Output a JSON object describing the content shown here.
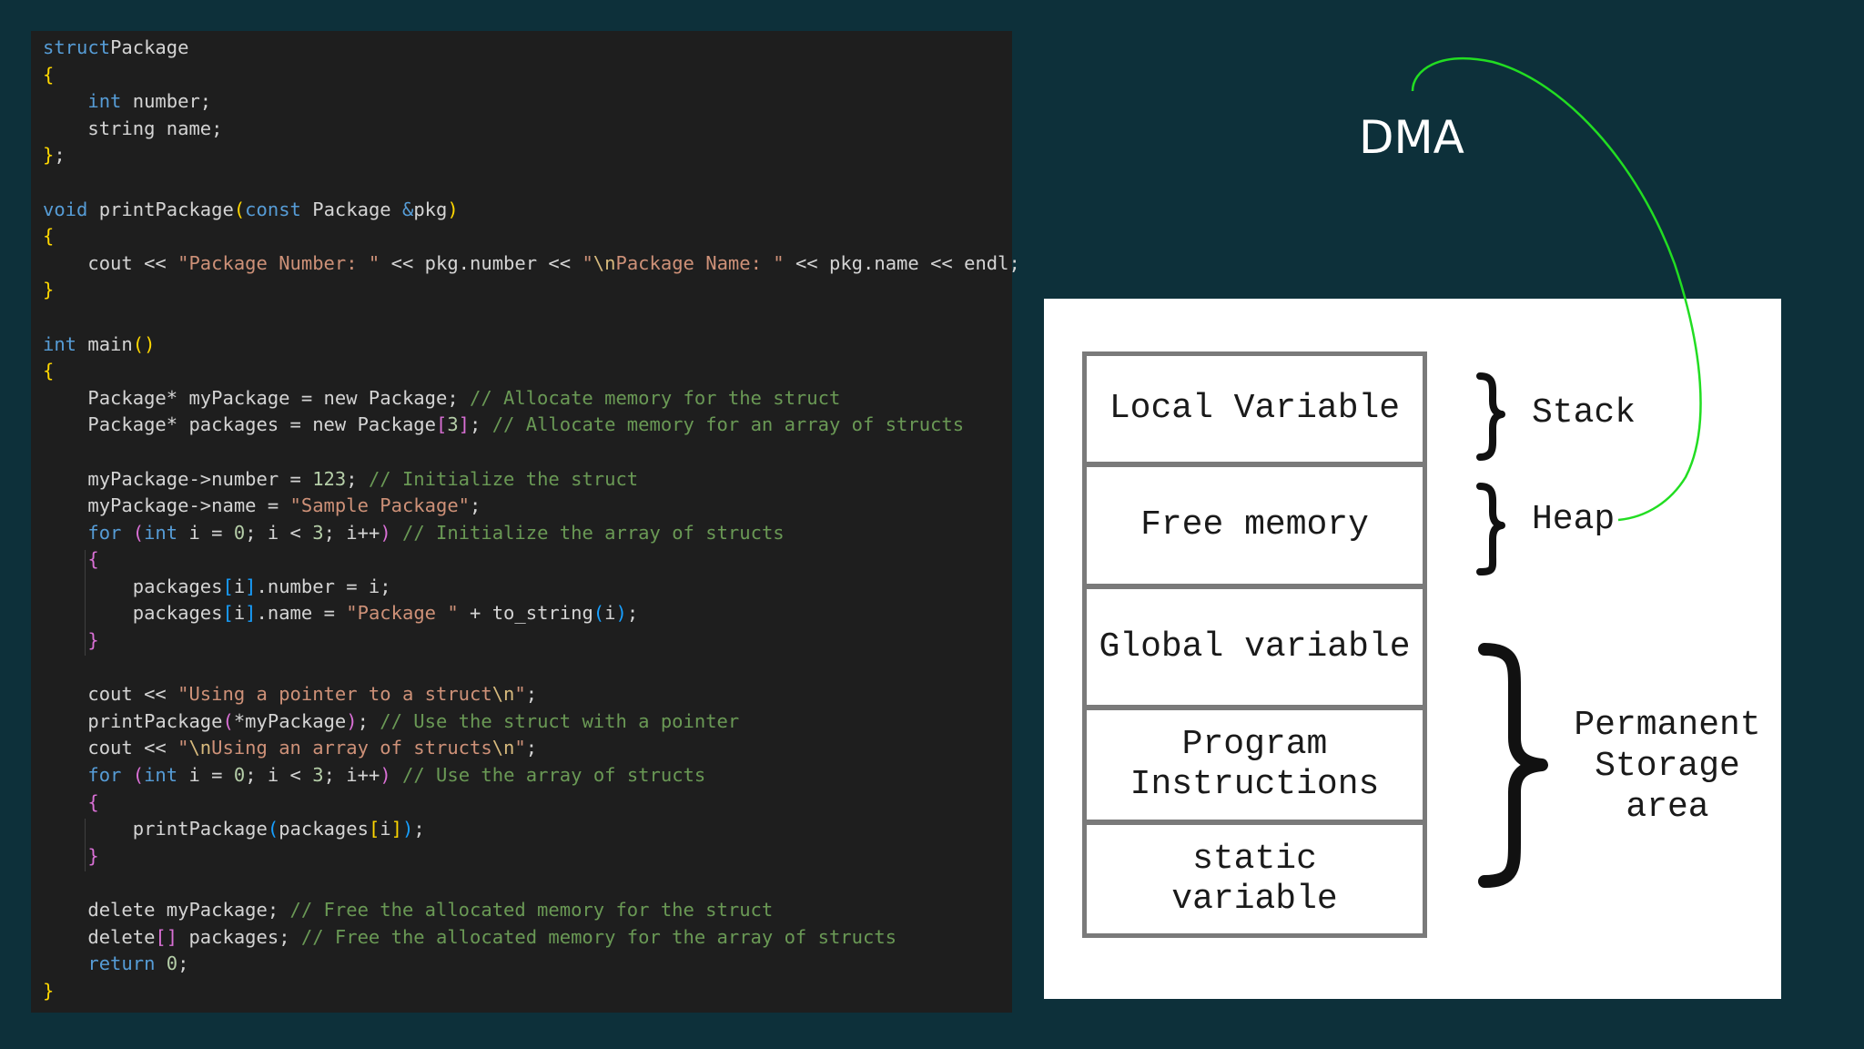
{
  "code": {
    "lines": [
      [
        [
          "kw",
          "struct"
        ],
        [
          "",
          "Package"
        ]
      ],
      [
        [
          "b1",
          "{"
        ]
      ],
      [
        [
          "",
          "    "
        ],
        [
          "kw",
          "int"
        ],
        [
          "",
          " number;"
        ]
      ],
      [
        [
          "",
          "    string name;"
        ]
      ],
      [
        [
          "b1",
          "}"
        ],
        [
          "",
          ";"
        ]
      ],
      [],
      [
        [
          "kw",
          "void"
        ],
        [
          "",
          " printPackage"
        ],
        [
          "b1",
          "("
        ],
        [
          "kw",
          "const"
        ],
        [
          "",
          " Package "
        ],
        [
          "kw",
          "&"
        ],
        [
          "",
          "pkg"
        ],
        [
          "b1",
          ")"
        ]
      ],
      [
        [
          "b1",
          "{"
        ]
      ],
      [
        [
          "",
          "    cout << "
        ],
        [
          "str",
          "\"Package Number: \""
        ],
        [
          "",
          " << pkg.number << "
        ],
        [
          "str",
          "\""
        ],
        [
          "esc",
          "\\n"
        ],
        [
          "str",
          "Package Name: \""
        ],
        [
          "",
          " << pkg.name << endl;"
        ]
      ],
      [
        [
          "b1",
          "}"
        ]
      ],
      [],
      [
        [
          "kw",
          "int"
        ],
        [
          "",
          " main"
        ],
        [
          "b1",
          "()"
        ]
      ],
      [
        [
          "b1",
          "{"
        ]
      ],
      [
        [
          "",
          "    Package* myPackage = new Package; "
        ],
        [
          "cmt",
          "// Allocate memory for the struct"
        ]
      ],
      [
        [
          "",
          "    Package* packages = new Package"
        ],
        [
          "b2",
          "["
        ],
        [
          "num",
          "3"
        ],
        [
          "b2",
          "]"
        ],
        [
          "",
          ";"
        ],
        [
          "cmt",
          " // Allocate memory for an array of structs"
        ]
      ],
      [],
      [
        [
          "",
          "    myPackage->number = "
        ],
        [
          "num",
          "123"
        ],
        [
          "",
          "; "
        ],
        [
          "cmt",
          "// Initialize the struct"
        ]
      ],
      [
        [
          "",
          "    myPackage->name = "
        ],
        [
          "str",
          "\"Sample Package\""
        ],
        [
          "",
          ";"
        ]
      ],
      [
        [
          "",
          "    "
        ],
        [
          "ctl",
          "for"
        ],
        [
          "",
          " "
        ],
        [
          "b2",
          "("
        ],
        [
          "kw",
          "int"
        ],
        [
          "",
          " i = "
        ],
        [
          "num",
          "0"
        ],
        [
          "",
          "; i < "
        ],
        [
          "num",
          "3"
        ],
        [
          "",
          "; i++"
        ],
        [
          "b2",
          ")"
        ],
        [
          "cmt",
          " // Initialize the array of structs"
        ]
      ],
      [
        [
          "",
          "    "
        ],
        [
          "b2",
          "{"
        ]
      ],
      [
        [
          "",
          "        packages"
        ],
        [
          "b3",
          "["
        ],
        [
          "",
          "i"
        ],
        [
          "b3",
          "]"
        ],
        [
          "",
          ".number = i;"
        ]
      ],
      [
        [
          "",
          "        packages"
        ],
        [
          "b3",
          "["
        ],
        [
          "",
          "i"
        ],
        [
          "b3",
          "]"
        ],
        [
          "",
          ".name = "
        ],
        [
          "str",
          "\"Package \""
        ],
        [
          "",
          " + to_string"
        ],
        [
          "b3",
          "("
        ],
        [
          "",
          "i"
        ],
        [
          "b3",
          ")"
        ],
        [
          "",
          ";"
        ]
      ],
      [
        [
          "",
          "    "
        ],
        [
          "b2",
          "}"
        ]
      ],
      [],
      [
        [
          "",
          "    cout << "
        ],
        [
          "str",
          "\"Using a pointer to a struct"
        ],
        [
          "esc",
          "\\n"
        ],
        [
          "str",
          "\""
        ],
        [
          "",
          ";"
        ]
      ],
      [
        [
          "",
          "    printPackage"
        ],
        [
          "b2",
          "("
        ],
        [
          "",
          "*myPackage"
        ],
        [
          "b2",
          ")"
        ],
        [
          "",
          "; "
        ],
        [
          "cmt",
          "// Use the struct with a pointer"
        ]
      ],
      [
        [
          "",
          "    cout << "
        ],
        [
          "str",
          "\""
        ],
        [
          "esc",
          "\\n"
        ],
        [
          "str",
          "Using an array of structs"
        ],
        [
          "esc",
          "\\n"
        ],
        [
          "str",
          "\""
        ],
        [
          "",
          ";"
        ]
      ],
      [
        [
          "",
          "    "
        ],
        [
          "ctl",
          "for"
        ],
        [
          "",
          " "
        ],
        [
          "b2",
          "("
        ],
        [
          "kw",
          "int"
        ],
        [
          "",
          " i = "
        ],
        [
          "num",
          "0"
        ],
        [
          "",
          "; i < "
        ],
        [
          "num",
          "3"
        ],
        [
          "",
          "; i++"
        ],
        [
          "b2",
          ")"
        ],
        [
          "cmt",
          " // Use the array of structs"
        ]
      ],
      [
        [
          "",
          "    "
        ],
        [
          "b2",
          "{"
        ]
      ],
      [
        [
          "",
          "        printPackage"
        ],
        [
          "b3",
          "("
        ],
        [
          "",
          "packages"
        ],
        [
          "b1",
          "["
        ],
        [
          "",
          "i"
        ],
        [
          "b1",
          "]"
        ],
        [
          "b3",
          ")"
        ],
        [
          "",
          ";"
        ]
      ],
      [
        [
          "",
          "    "
        ],
        [
          "b2",
          "}"
        ]
      ],
      [],
      [
        [
          "",
          "    delete myPackage; "
        ],
        [
          "cmt",
          "// Free the allocated memory for the struct"
        ]
      ],
      [
        [
          "",
          "    delete"
        ],
        [
          "b2",
          "[]"
        ],
        [
          "",
          " packages; "
        ],
        [
          "cmt",
          "// Free the allocated memory for the array of structs"
        ]
      ],
      [
        [
          "",
          "    "
        ],
        [
          "ctl",
          "return"
        ],
        [
          "",
          " "
        ],
        [
          "num",
          "0"
        ],
        [
          "",
          ";"
        ]
      ],
      [
        [
          "b1",
          "}"
        ]
      ]
    ]
  },
  "diagram": {
    "dma_label": "DMA",
    "cells": [
      "Local Variable",
      "Free memory",
      "Global variable",
      "Program\nInstructions",
      "static\nvariable"
    ],
    "labels": {
      "stack": "Stack",
      "heap": "Heap",
      "permanent": "Permanent\nStorage\narea"
    },
    "arrow_color": "#22dd22"
  }
}
